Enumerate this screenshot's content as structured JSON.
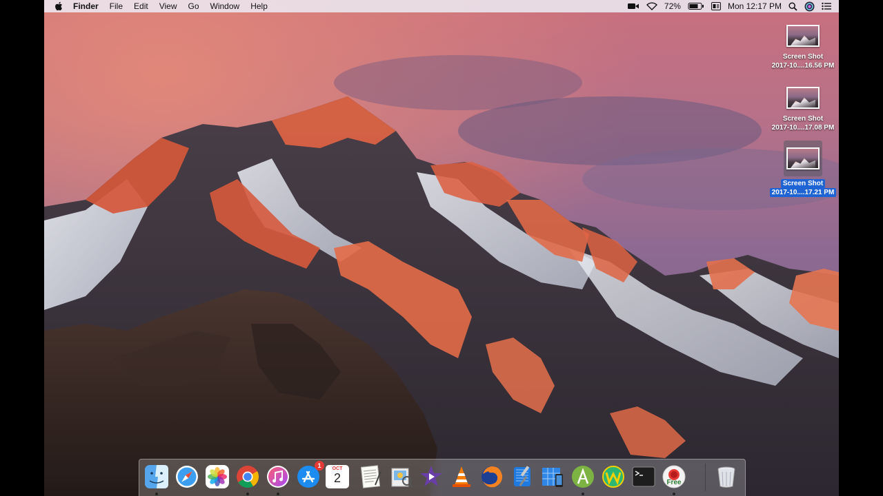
{
  "menubar": {
    "app_name": "Finder",
    "menus": [
      "File",
      "Edit",
      "View",
      "Go",
      "Window",
      "Help"
    ],
    "battery_percent": "72%",
    "clock": "Mon 12:17 PM"
  },
  "desktop": {
    "icons": [
      {
        "name": "Screen Shot",
        "date": "2017-10....16.56 PM",
        "selected": false
      },
      {
        "name": "Screen Shot",
        "date": "2017-10....17.08 PM",
        "selected": false
      },
      {
        "name": "Screen Shot",
        "date": "2017-10....17.21 PM",
        "selected": true
      }
    ]
  },
  "dock": {
    "items": [
      {
        "app": "Finder",
        "icon": "finder-icon",
        "running": true
      },
      {
        "app": "Safari",
        "icon": "safari-icon",
        "running": false
      },
      {
        "app": "Photos",
        "icon": "photos-icon",
        "running": false
      },
      {
        "app": "Google Chrome",
        "icon": "chrome-icon",
        "running": true
      },
      {
        "app": "iTunes",
        "icon": "itunes-icon",
        "running": true
      },
      {
        "app": "App Store",
        "icon": "app-store-icon",
        "running": false,
        "badge": "1"
      },
      {
        "app": "Calendar",
        "icon": "calendar-icon",
        "running": false,
        "month": "OCT",
        "day": "2"
      },
      {
        "app": "TextEdit",
        "icon": "textedit-icon",
        "running": false
      },
      {
        "app": "Preview",
        "icon": "preview-icon",
        "running": false
      },
      {
        "app": "iMovie",
        "icon": "imovie-icon",
        "running": false
      },
      {
        "app": "VLC",
        "icon": "vlc-icon",
        "running": false
      },
      {
        "app": "Firefox",
        "icon": "firefox-icon",
        "running": false
      },
      {
        "app": "Xcode",
        "icon": "xcode-icon",
        "running": false
      },
      {
        "app": "Simulator",
        "icon": "simulator-icon",
        "running": false
      },
      {
        "app": "Android Studio",
        "icon": "android-studio-icon",
        "running": true
      },
      {
        "app": "Wunderlist",
        "icon": "wunderlist-icon",
        "running": false
      },
      {
        "app": "Terminal",
        "icon": "terminal-icon",
        "running": false
      },
      {
        "app": "Free",
        "icon": "free-app-icon",
        "running": true,
        "label": "Free"
      },
      {
        "app": "Trash",
        "icon": "trash-icon",
        "running": false
      }
    ]
  }
}
